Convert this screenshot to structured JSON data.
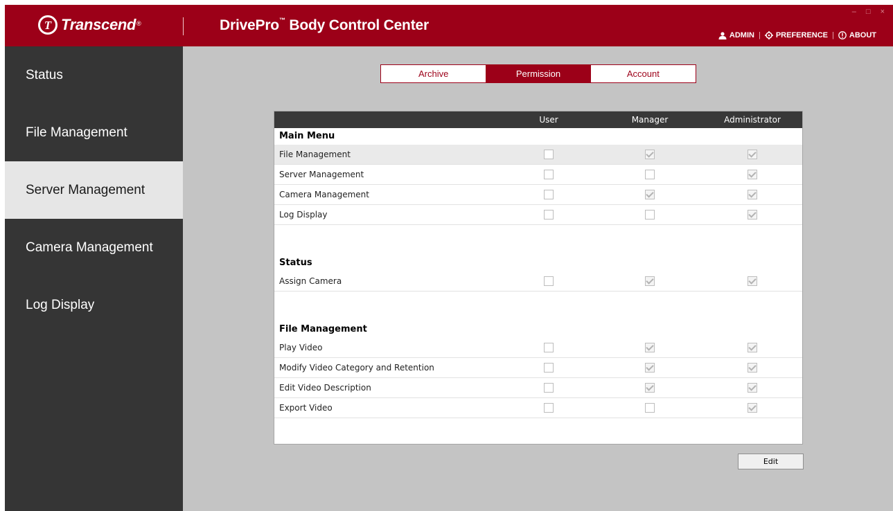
{
  "header": {
    "logo_text": "Transcend",
    "logo_mark": "T",
    "logo_reg": "®",
    "app_title_main": "DrivePro",
    "app_title_tm": "™",
    "app_title_rest": " Body Control Center",
    "window_controls": [
      "–",
      "□",
      "×"
    ],
    "nav": {
      "admin": "ADMIN",
      "preference": "PREFERENCE",
      "about": "ABOUT",
      "separator": "|"
    }
  },
  "sidebar": {
    "items": [
      {
        "label": "Status"
      },
      {
        "label": "File Management"
      },
      {
        "label": "Server Management"
      },
      {
        "label": "Camera Management"
      },
      {
        "label": "Log Display"
      }
    ],
    "active_index": 2
  },
  "tabs": [
    {
      "label": "Archive"
    },
    {
      "label": "Permission"
    },
    {
      "label": "Account"
    }
  ],
  "active_tab": 1,
  "permissions": {
    "columns": [
      "User",
      "Manager",
      "Administrator"
    ],
    "sections": [
      {
        "title": "Main Menu",
        "rows": [
          {
            "label": "File Management",
            "values": [
              false,
              true,
              true
            ]
          },
          {
            "label": "Server Management",
            "values": [
              false,
              false,
              true
            ]
          },
          {
            "label": "Camera Management",
            "values": [
              false,
              true,
              true
            ]
          },
          {
            "label": "Log Display",
            "values": [
              false,
              false,
              true
            ]
          }
        ]
      },
      {
        "title": "Status",
        "rows": [
          {
            "label": "Assign Camera",
            "values": [
              false,
              true,
              true
            ]
          }
        ]
      },
      {
        "title": "File Management",
        "rows": [
          {
            "label": "Play Video",
            "values": [
              false,
              true,
              true
            ]
          },
          {
            "label": "Modify Video Category and Retention",
            "values": [
              false,
              true,
              true
            ]
          },
          {
            "label": "Edit Video Description",
            "values": [
              false,
              true,
              true
            ]
          },
          {
            "label": "Export Video",
            "values": [
              false,
              false,
              true
            ]
          }
        ]
      }
    ]
  },
  "edit_button": "Edit",
  "colors": {
    "brand_red": "#9c0018",
    "sidebar_bg": "#353535",
    "main_bg": "#c4c4c4",
    "table_header": "#383838"
  }
}
